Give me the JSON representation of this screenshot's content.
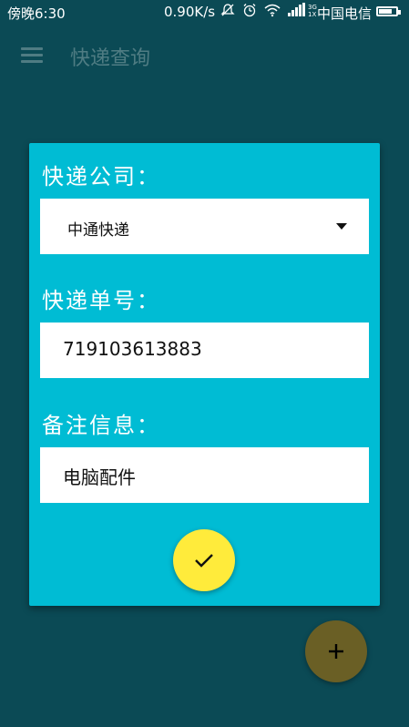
{
  "status_bar": {
    "time": "傍晚6:30",
    "speed": "0.90K/s",
    "carrier": "中国电信",
    "battery_level": 0.8,
    "icons": [
      "mute-icon",
      "alarm-icon",
      "wifi-icon",
      "signal-icon"
    ]
  },
  "app_bar": {
    "title": "快递查询",
    "menu_icon": "menu-icon"
  },
  "form": {
    "company_label": "快递公司：",
    "company_value": "中通快递",
    "number_label": "快递单号：",
    "number_value": "719103613883",
    "note_label": "备注信息：",
    "note_value": "电脑配件"
  },
  "buttons": {
    "confirm_icon": "check-icon",
    "add_icon": "plus-icon"
  },
  "colors": {
    "background": "#0b4a55",
    "card": "#00bcd4",
    "confirm_fab": "#ffeb3b",
    "add_fab": "#6a5f25"
  }
}
